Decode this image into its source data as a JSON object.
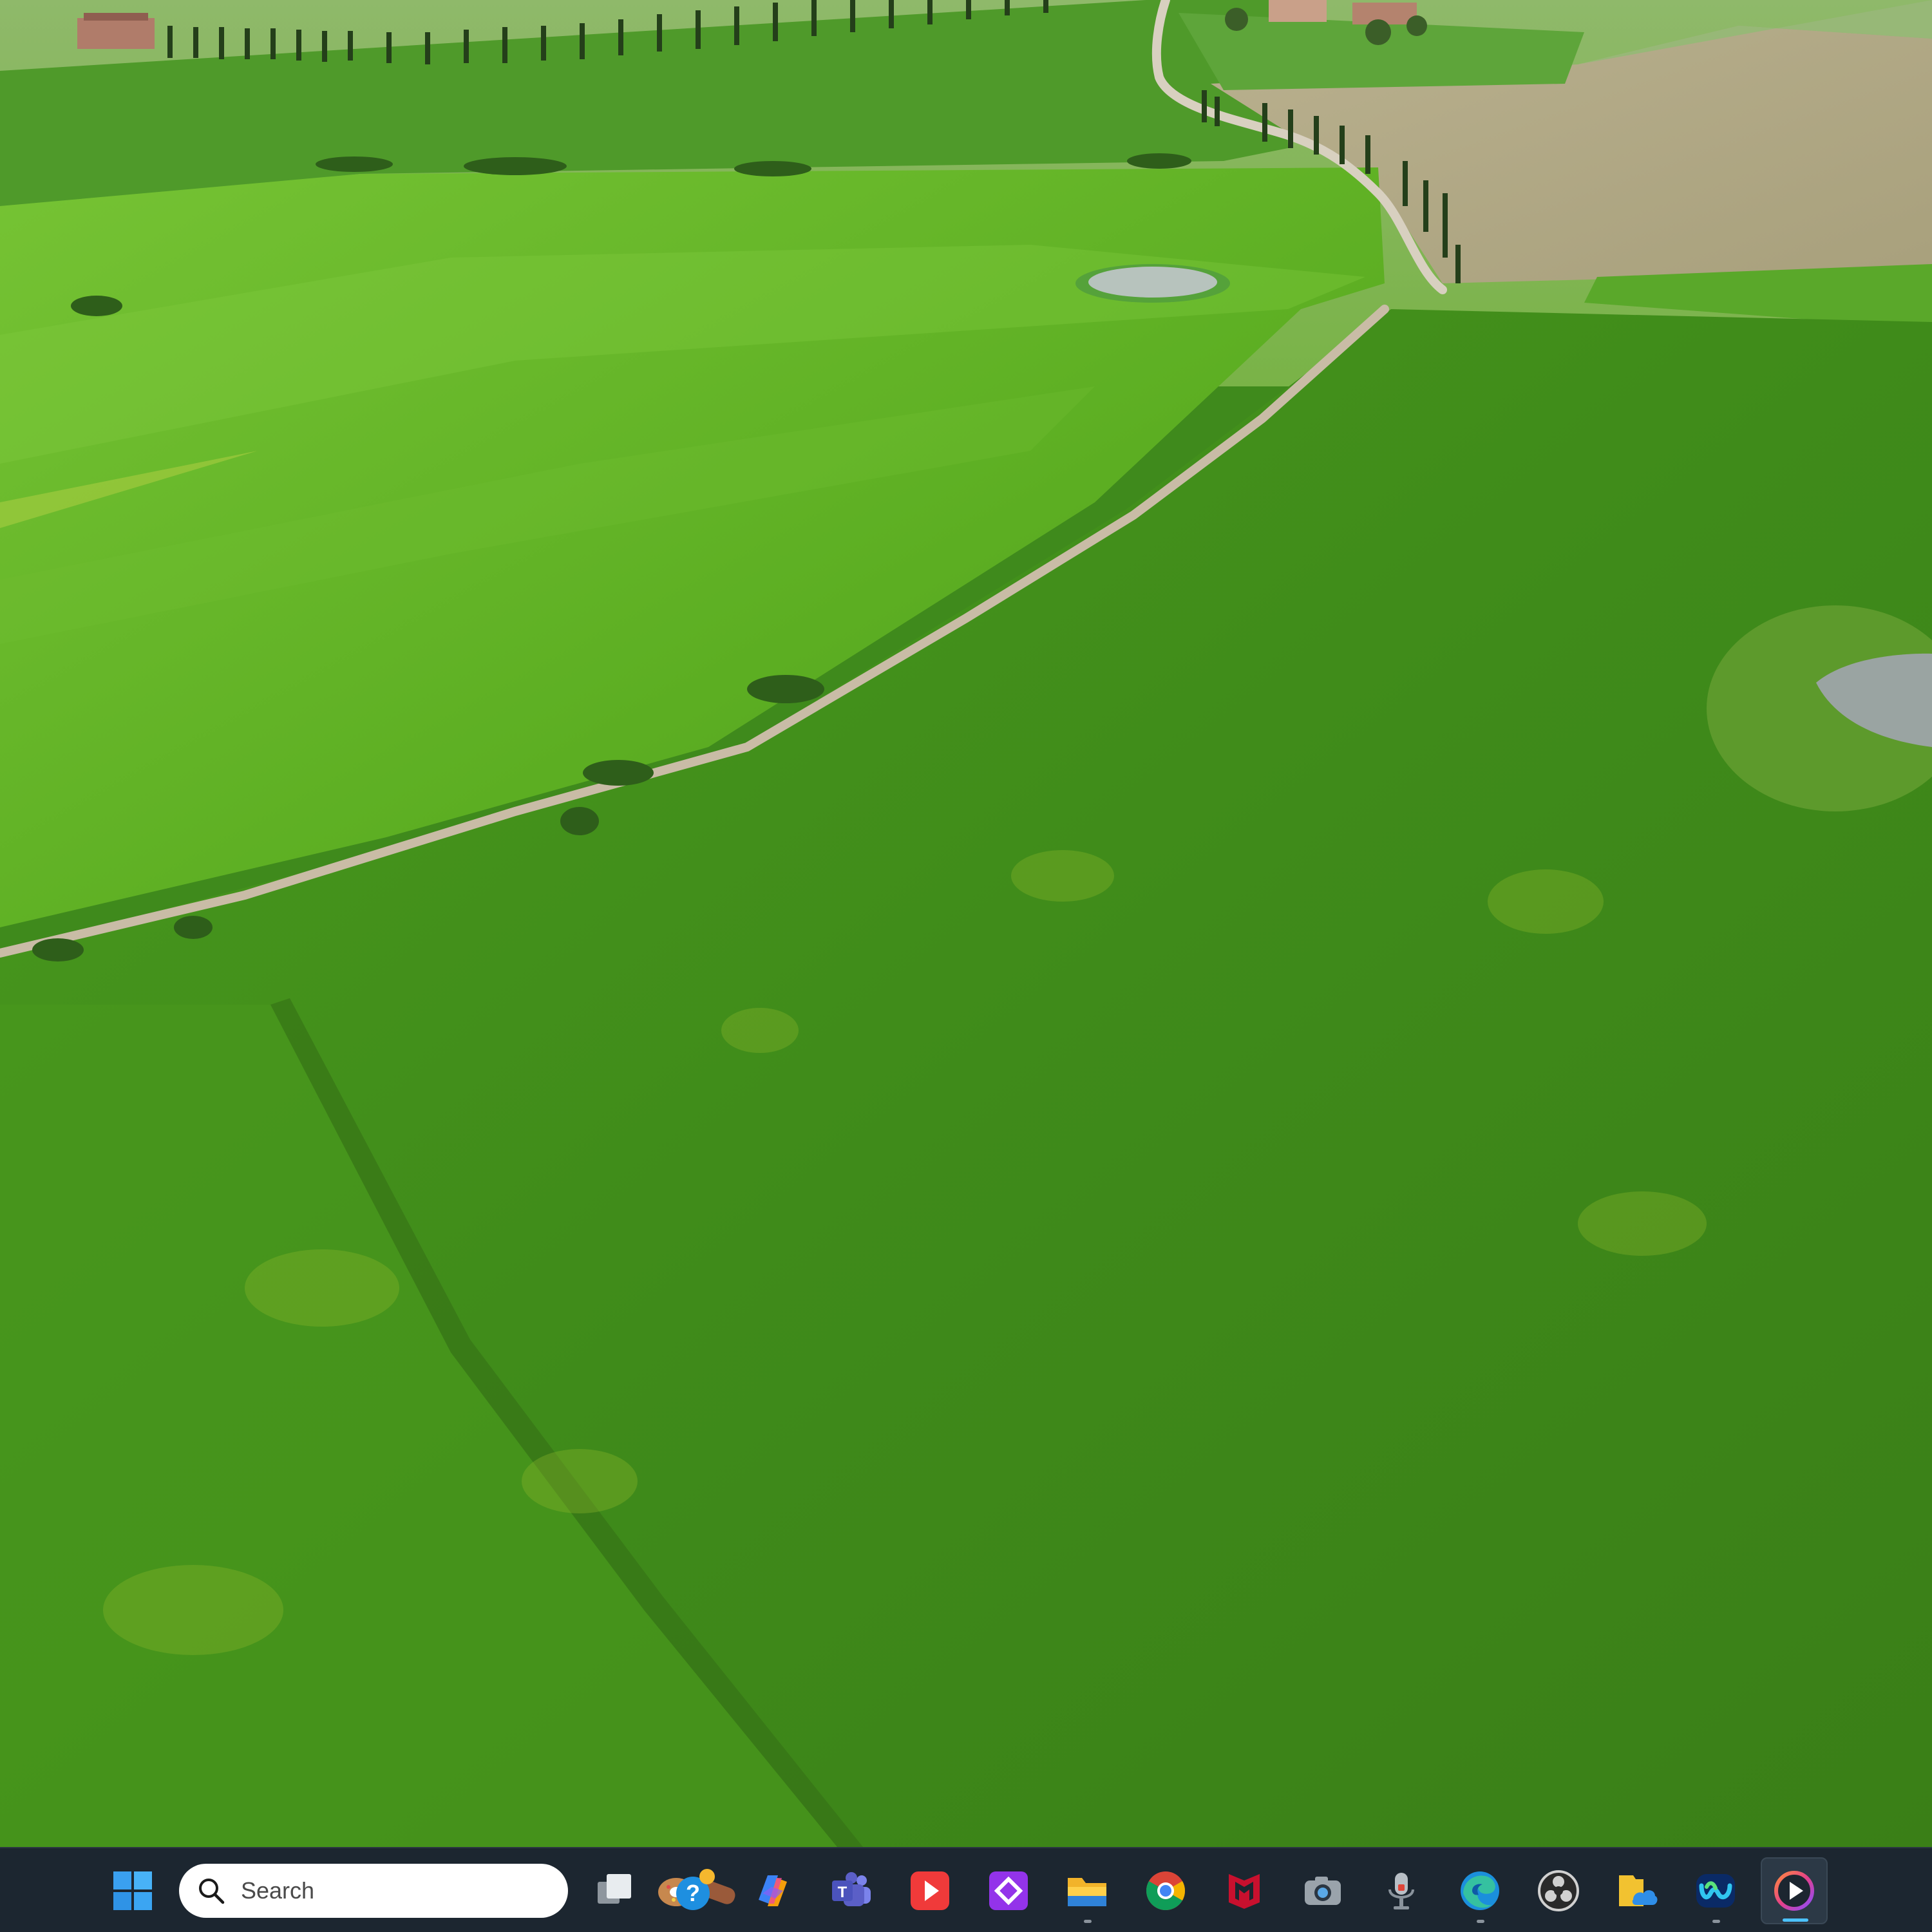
{
  "desktop": {
    "wallpaper": "aerial-green-fields-dirt-road",
    "colors": {
      "field_dark": "#3d8a1b",
      "field_light": "#6bbf2c",
      "road": "#c7b9a4",
      "taskbar": "#1c2630"
    }
  },
  "taskbar": {
    "search": {
      "label": "Search",
      "icon": "search-icon"
    },
    "apps": [
      {
        "id": "start",
        "icon": "windows-logo-icon"
      },
      {
        "id": "task-view",
        "icon": "task-view-icon"
      },
      {
        "id": "get-help",
        "icon": "help-icon"
      },
      {
        "id": "copilot",
        "icon": "copilot-icon"
      },
      {
        "id": "teams",
        "icon": "teams-icon"
      },
      {
        "id": "video-player",
        "icon": "play-icon"
      },
      {
        "id": "diamond-app",
        "icon": "diamond-icon"
      },
      {
        "id": "file-explorer",
        "icon": "folder-icon",
        "running": true
      },
      {
        "id": "chrome",
        "icon": "chrome-icon"
      },
      {
        "id": "mcafee",
        "icon": "mcafee-icon"
      },
      {
        "id": "camera",
        "icon": "camera-icon"
      },
      {
        "id": "voice-recorder",
        "icon": "microphone-icon"
      },
      {
        "id": "edge",
        "icon": "edge-icon",
        "running": true
      },
      {
        "id": "obs",
        "icon": "obs-icon"
      },
      {
        "id": "files-cloud",
        "icon": "cloud-files-icon"
      },
      {
        "id": "webex",
        "icon": "webex-icon",
        "running": true
      },
      {
        "id": "media-player",
        "icon": "media-player-icon",
        "running": true,
        "active": true
      }
    ]
  }
}
